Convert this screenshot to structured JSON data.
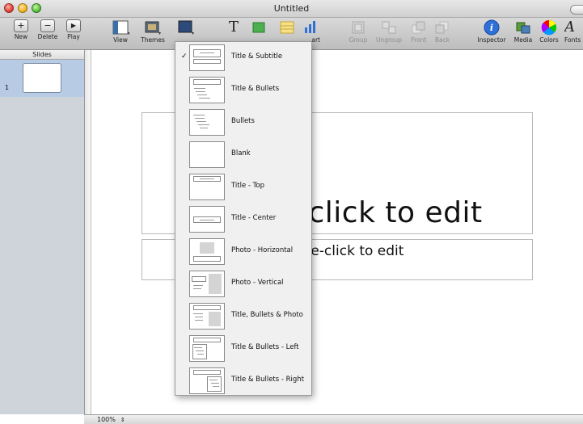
{
  "window": {
    "title": "Untitled"
  },
  "toolbar": {
    "new": "New",
    "delete": "Delete",
    "play": "Play",
    "view": "View",
    "themes": "Themes",
    "chart_fragment": "art",
    "group": "Group",
    "ungroup": "Ungroup",
    "front": "Front",
    "back": "Back",
    "inspector": "Inspector",
    "media": "Media",
    "colors": "Colors",
    "fonts": "Fonts"
  },
  "sidebar": {
    "header": "Slides",
    "slide_number": "1"
  },
  "canvas": {
    "title_placeholder": "Double-click to edit",
    "body_placeholder": "Double-click to edit"
  },
  "status": {
    "zoom": "100%"
  },
  "master_menu": {
    "selected_index": 0,
    "items": [
      {
        "label": "Title & Subtitle",
        "checked": true
      },
      {
        "label": "Title & Bullets"
      },
      {
        "label": "Bullets"
      },
      {
        "label": "Blank"
      },
      {
        "label": "Title - Top"
      },
      {
        "label": "Title - Center"
      },
      {
        "label": "Photo - Horizontal"
      },
      {
        "label": "Photo - Vertical"
      },
      {
        "label": "Title, Bullets & Photo"
      },
      {
        "label": "Title & Bullets - Left"
      },
      {
        "label": "Title & Bullets - Right"
      }
    ]
  },
  "colors": {
    "accent_blue": "#2e6fd8",
    "chart_green": "#4caf50",
    "selection": "#b8cbe4"
  }
}
